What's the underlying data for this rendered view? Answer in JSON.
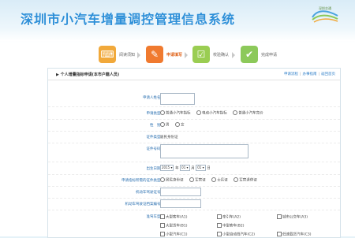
{
  "header": {
    "site_title": "深圳市小汽车增量调控管理信息系统",
    "logo_text": "深圳交通"
  },
  "steps": [
    {
      "label": "阅读须知",
      "color": "#f1a93b",
      "glyph": "⌨"
    },
    {
      "label": "申请填写",
      "color": "#f07a2f",
      "glyph": "✎"
    },
    {
      "label": "校验确认",
      "color": "#9acd52",
      "glyph": "☑"
    },
    {
      "label": "完成申请",
      "color": "#8cc95a",
      "glyph": "✔"
    }
  ],
  "panel": {
    "title": "个人增量指标申请(本市户籍人员)",
    "links": [
      "申请流程",
      "办事指南",
      "返回首页"
    ]
  },
  "form": {
    "applicant_name_label": "申请人姓名:",
    "apply_type_label": "申请类型:",
    "apply_type_options": [
      "普通小汽车指标",
      "电动小汽车指标",
      "普通小汽车竞价"
    ],
    "gender_label": "性　别:",
    "gender_options": [
      "男",
      "女"
    ],
    "id_type_label": "证件类型:",
    "id_type_value": "居民身份证",
    "id_number_label": "证件号码:",
    "birth_label": "出生日期:",
    "birth_year": "2015",
    "birth_year_suffix": "年",
    "birth_month": "01",
    "birth_month_suffix": "月",
    "birth_day": "01",
    "birth_day_suffix": "日",
    "holder_id_type_label": "申请指标所需的证件类型:",
    "holder_id_options": [
      "居民身份证",
      "军官证",
      "士兵证",
      "军官退休证"
    ],
    "vehicle_reg_label": "机动车驾驶证号:",
    "vehicle_file_label": "机动车驾驶证档案编号:",
    "license_type_label": "准驾车型:",
    "license_types": [
      [
        "大型客车(A1)",
        "牵引车(A2)",
        "城市公交车(A3)"
      ],
      [
        "大型货车(B1)",
        "中型客车(B2)",
        ""
      ],
      [
        "小型汽车(C1)",
        "小型自动挡汽车(C2)",
        "低速载货汽车(C3)"
      ]
    ]
  }
}
